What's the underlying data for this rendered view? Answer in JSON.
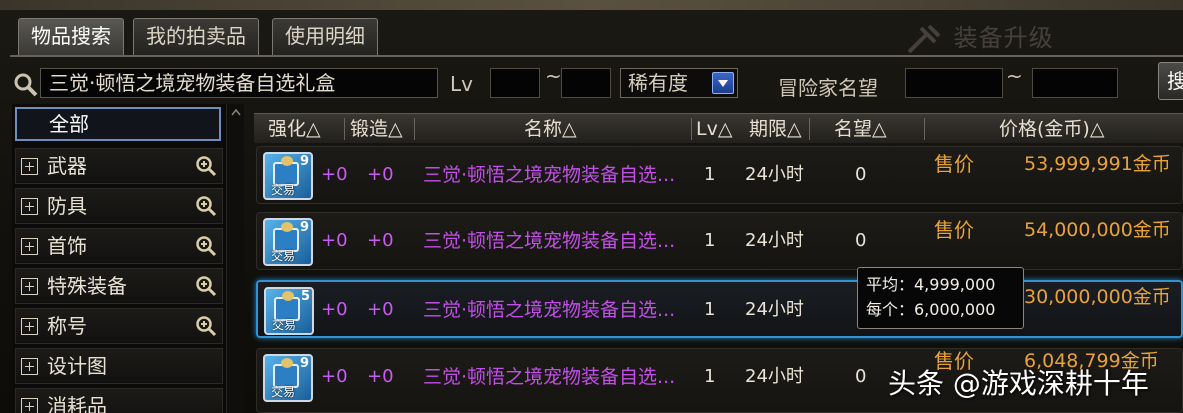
{
  "tabs": [
    {
      "label": "物品搜索",
      "active": true
    },
    {
      "label": "我的拍卖品",
      "active": false
    },
    {
      "label": "使用明细",
      "active": false
    }
  ],
  "header": {
    "upgrade_label": "装备升级"
  },
  "search": {
    "value": "三觉·顿悟之境宠物装备自选礼盒",
    "lv_label": "Lv",
    "tilde": "~",
    "rarity": "稀有度",
    "fame_label": "冒险家名望",
    "fame_tilde": "~",
    "go_label": "搜"
  },
  "sidebar": {
    "selected": "全部",
    "items": [
      {
        "label": "武器",
        "zoom": true
      },
      {
        "label": "防具",
        "zoom": true
      },
      {
        "label": "首饰",
        "zoom": true
      },
      {
        "label": "特殊装备",
        "zoom": true
      },
      {
        "label": "称号",
        "zoom": true
      },
      {
        "label": "设计图",
        "zoom": false
      },
      {
        "label": "消耗品",
        "zoom": false
      }
    ]
  },
  "table": {
    "headers": {
      "enhance": "强化△",
      "forge": "锻造△",
      "name": "名称△",
      "lv": "Lv△",
      "period": "期限△",
      "fame": "名望△",
      "price": "价格(金币)△"
    },
    "rows": [
      {
        "qty": "9",
        "trade": "交易",
        "enhance": "+0",
        "forge": "+0",
        "name": "三觉·顿悟之境宠物装备自选...",
        "lv": "1",
        "period": "24小时",
        "fame": "0",
        "sale": "售价",
        "price": "53,999,991金币",
        "selected": false
      },
      {
        "qty": "9",
        "trade": "交易",
        "enhance": "+0",
        "forge": "+0",
        "name": "三觉·顿悟之境宠物装备自选...",
        "lv": "1",
        "period": "24小时",
        "fame": "0",
        "sale": "售价",
        "price": "54,000,000金币",
        "selected": false
      },
      {
        "qty": "5",
        "trade": "交易",
        "enhance": "+0",
        "forge": "+0",
        "name": "三觉·顿悟之境宠物装备自选...",
        "lv": "1",
        "period": "24小时",
        "fame": "",
        "sale": "",
        "price": "30,000,000金币",
        "selected": true
      },
      {
        "qty": "9",
        "trade": "交易",
        "enhance": "+0",
        "forge": "+0",
        "name": "三觉·顿悟之境宠物装备自选...",
        "lv": "1",
        "period": "24小时",
        "fame": "0",
        "sale": "售价",
        "price": "6,048,799金币",
        "selected": false
      }
    ]
  },
  "tooltip": {
    "avg_label": "平均：4,999,000",
    "each_label": "每个：6,000,000"
  },
  "watermark": "头条 @游戏深耕十年",
  "colors": {
    "item_name": "#c34fe8",
    "price": "#e7a23a",
    "selection": "#2f93d6"
  }
}
